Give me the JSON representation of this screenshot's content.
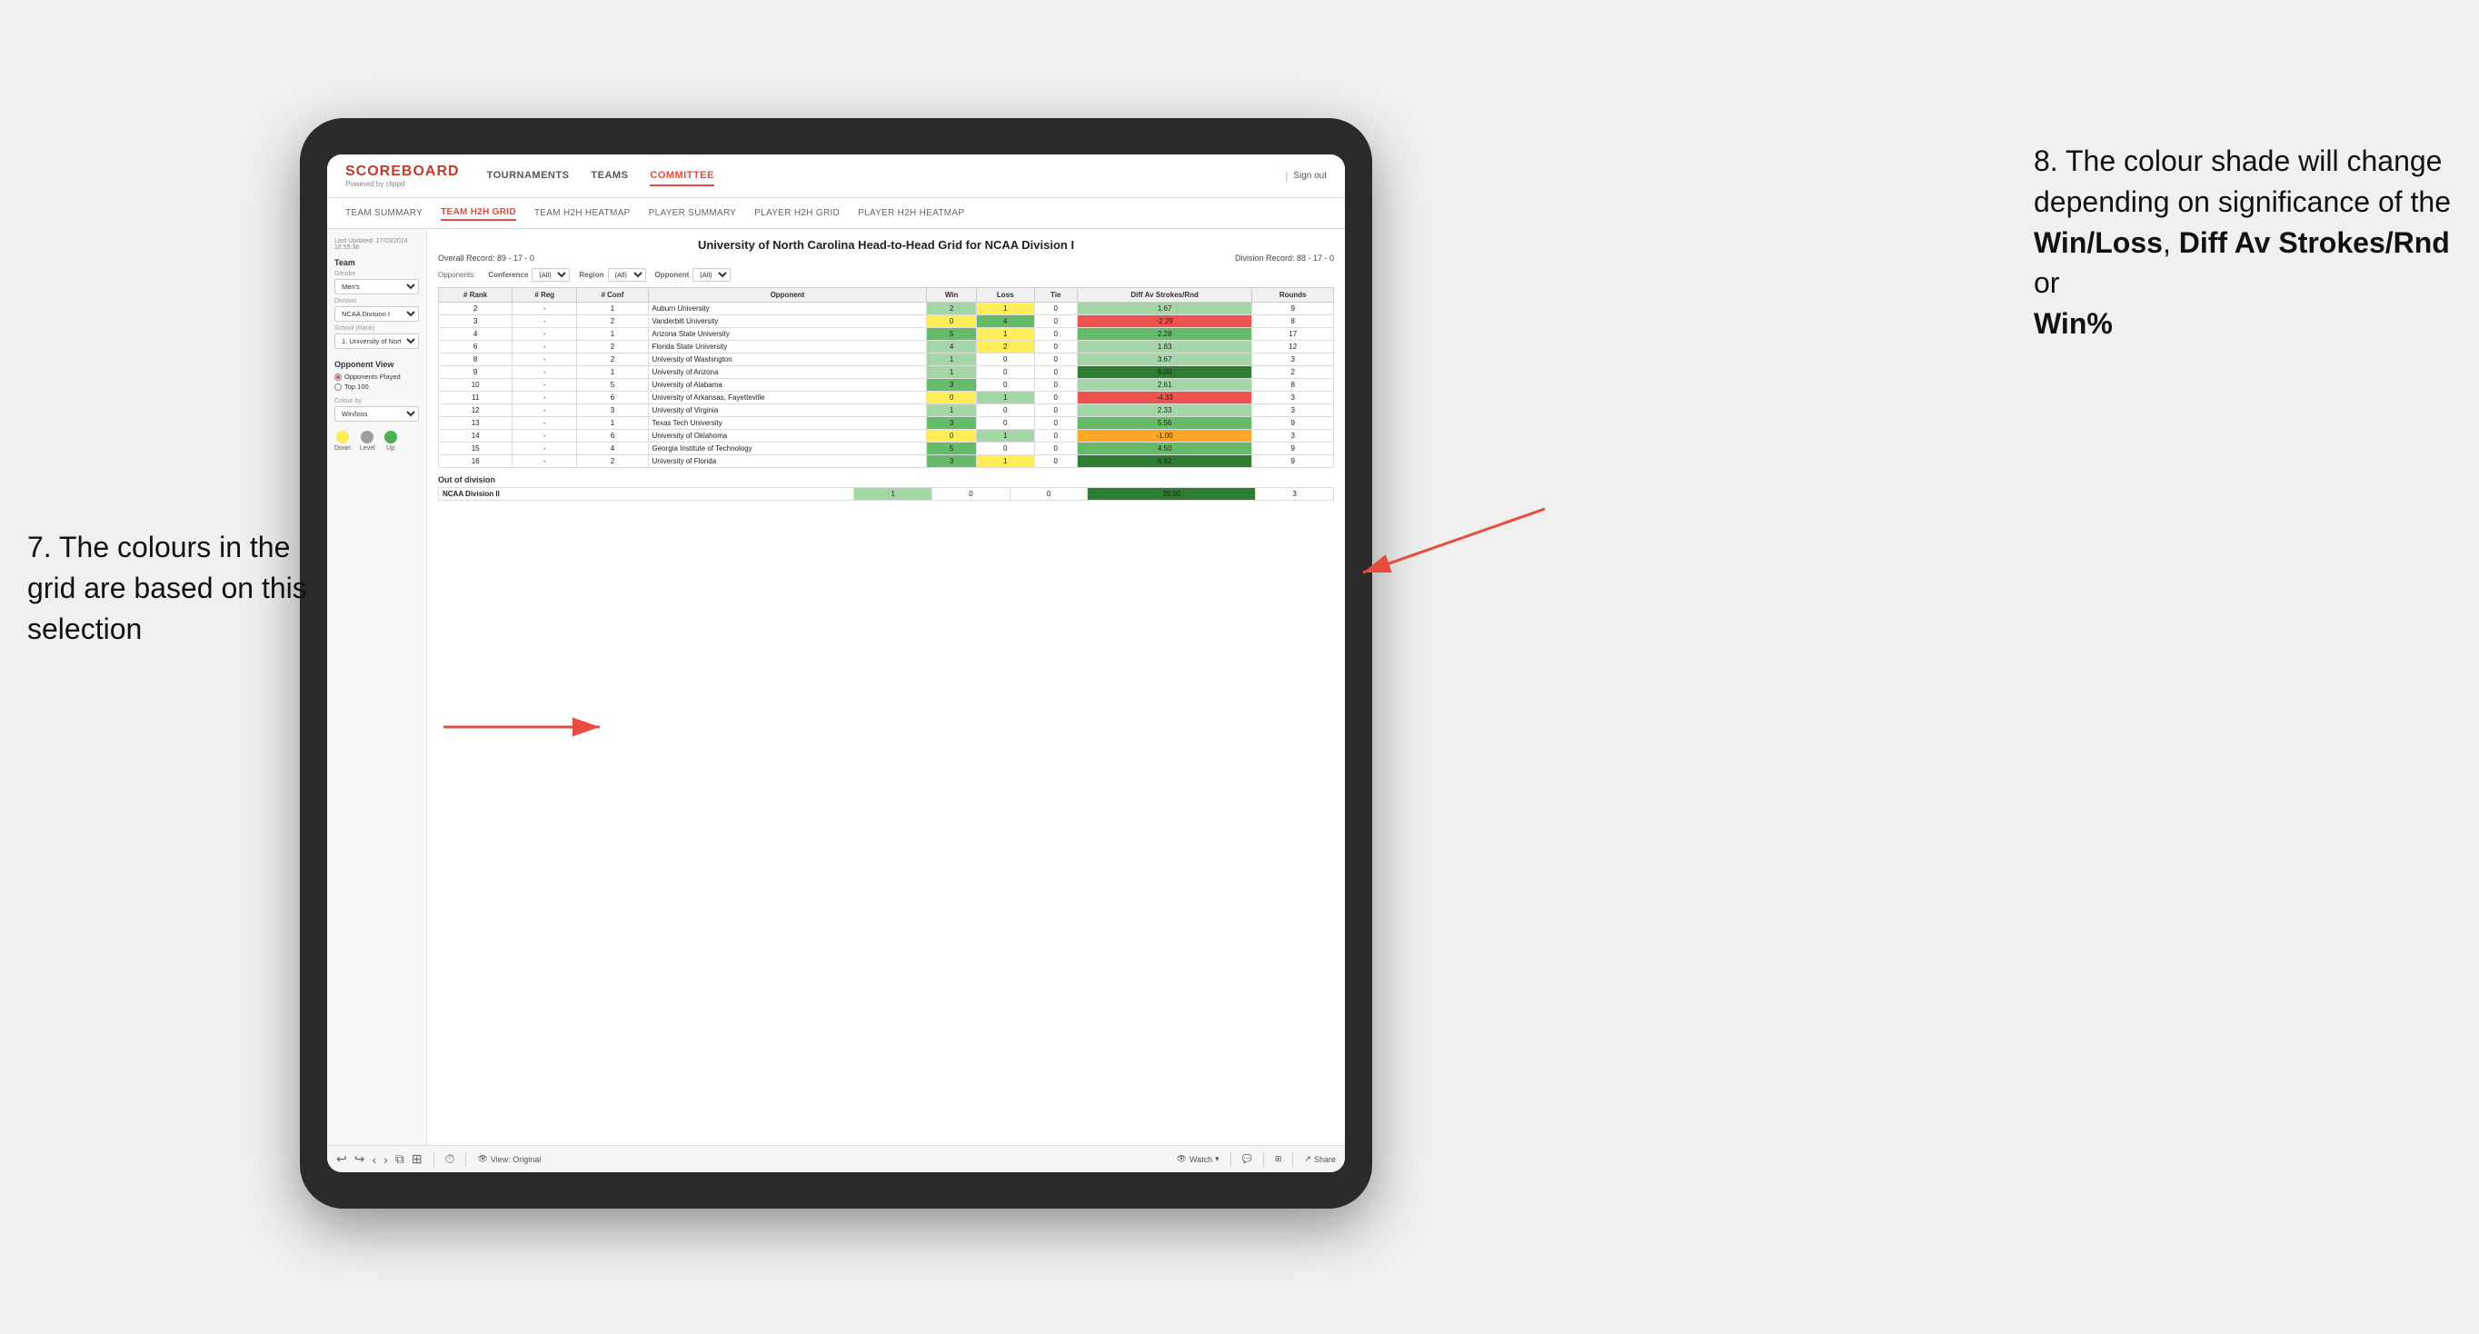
{
  "annotations": {
    "left_title": "7. The colours in the grid are based on this selection",
    "right_title": "8. The colour shade will change depending on significance of the",
    "right_bold1": "Win/Loss",
    "right_comma": ", ",
    "right_bold2": "Diff Av Strokes/Rnd",
    "right_or": " or",
    "right_bold3": "Win%"
  },
  "header": {
    "logo": "SCOREBOARD",
    "logo_sub": "Powered by clippd",
    "nav_items": [
      "TOURNAMENTS",
      "TEAMS",
      "COMMITTEE"
    ],
    "sign_out": "Sign out"
  },
  "sub_nav": {
    "items": [
      "TEAM SUMMARY",
      "TEAM H2H GRID",
      "TEAM H2H HEATMAP",
      "PLAYER SUMMARY",
      "PLAYER H2H GRID",
      "PLAYER H2H HEATMAP"
    ],
    "active": "TEAM H2H GRID"
  },
  "left_panel": {
    "updated_label": "Last Updated: 27/03/2024",
    "updated_time": "16:55:38",
    "team_section": "Team",
    "gender_label": "Gender",
    "gender_value": "Men's",
    "division_label": "Division",
    "division_value": "NCAA Division I",
    "school_label": "School (Rank)",
    "school_value": "1. University of Nort...",
    "opponent_label": "Opponent View",
    "opponent_options": [
      "Opponents Played",
      "Top 100"
    ],
    "opponent_selected": "Opponents Played",
    "colour_label": "Colour by",
    "colour_value": "Win/loss",
    "legend": {
      "down_label": "Down",
      "level_label": "Level",
      "up_label": "Up",
      "down_color": "#ffee58",
      "level_color": "#9e9e9e",
      "up_color": "#4caf50"
    }
  },
  "report": {
    "title": "University of North Carolina Head-to-Head Grid for NCAA Division I",
    "overall_record": "Overall Record: 89 - 17 - 0",
    "division_record": "Division Record: 88 - 17 - 0",
    "filters": {
      "opponents_label": "Opponents:",
      "conference_label": "Conference",
      "conference_value": "(All)",
      "region_label": "Region",
      "region_value": "(All)",
      "opponent_label": "Opponent",
      "opponent_value": "(All)"
    },
    "table_headers": [
      "#\nRank",
      "#\nReg",
      "#\nConf",
      "Opponent",
      "Win",
      "Loss",
      "Tie",
      "Diff Av\nStrokes/Rnd",
      "Rounds"
    ],
    "rows": [
      {
        "rank": "2",
        "reg": "-",
        "conf": "1",
        "opponent": "Auburn University",
        "win": "2",
        "loss": "1",
        "tie": "0",
        "diff": "1.67",
        "rounds": "9",
        "win_color": "green_light",
        "loss_color": "yellow",
        "diff_color": "green_light"
      },
      {
        "rank": "3",
        "reg": "-",
        "conf": "2",
        "opponent": "Vanderbilt University",
        "win": "0",
        "loss": "4",
        "tie": "0",
        "diff": "-2.29",
        "rounds": "8",
        "win_color": "yellow",
        "loss_color": "green_med",
        "diff_color": "red"
      },
      {
        "rank": "4",
        "reg": "-",
        "conf": "1",
        "opponent": "Arizona State University",
        "win": "5",
        "loss": "1",
        "tie": "0",
        "diff": "2.28",
        "rounds": "17",
        "win_color": "green_med",
        "loss_color": "yellow",
        "diff_color": "green_med"
      },
      {
        "rank": "6",
        "reg": "-",
        "conf": "2",
        "opponent": "Florida State University",
        "win": "4",
        "loss": "2",
        "tie": "0",
        "diff": "1.83",
        "rounds": "12",
        "win_color": "green_light",
        "loss_color": "yellow",
        "diff_color": "green_light"
      },
      {
        "rank": "8",
        "reg": "-",
        "conf": "2",
        "opponent": "University of Washington",
        "win": "1",
        "loss": "0",
        "tie": "0",
        "diff": "3.67",
        "rounds": "3",
        "win_color": "green_light",
        "loss_color": "neutral",
        "diff_color": "green_light"
      },
      {
        "rank": "9",
        "reg": "-",
        "conf": "1",
        "opponent": "University of Arizona",
        "win": "1",
        "loss": "0",
        "tie": "0",
        "diff": "9.00",
        "rounds": "2",
        "win_color": "green_light",
        "loss_color": "neutral",
        "diff_color": "green_dark"
      },
      {
        "rank": "10",
        "reg": "-",
        "conf": "5",
        "opponent": "University of Alabama",
        "win": "3",
        "loss": "0",
        "tie": "0",
        "diff": "2.61",
        "rounds": "8",
        "win_color": "green_med",
        "loss_color": "neutral",
        "diff_color": "green_light"
      },
      {
        "rank": "11",
        "reg": "-",
        "conf": "6",
        "opponent": "University of Arkansas, Fayetteville",
        "win": "0",
        "loss": "1",
        "tie": "0",
        "diff": "-4.33",
        "rounds": "3",
        "win_color": "yellow",
        "loss_color": "green_light",
        "diff_color": "red"
      },
      {
        "rank": "12",
        "reg": "-",
        "conf": "3",
        "opponent": "University of Virginia",
        "win": "1",
        "loss": "0",
        "tie": "0",
        "diff": "2.33",
        "rounds": "3",
        "win_color": "green_light",
        "loss_color": "neutral",
        "diff_color": "green_light"
      },
      {
        "rank": "13",
        "reg": "-",
        "conf": "1",
        "opponent": "Texas Tech University",
        "win": "3",
        "loss": "0",
        "tie": "0",
        "diff": "5.56",
        "rounds": "9",
        "win_color": "green_med",
        "loss_color": "neutral",
        "diff_color": "green_med"
      },
      {
        "rank": "14",
        "reg": "-",
        "conf": "6",
        "opponent": "University of Oklahoma",
        "win": "0",
        "loss": "1",
        "tie": "0",
        "diff": "-1.00",
        "rounds": "3",
        "win_color": "yellow",
        "loss_color": "green_light",
        "diff_color": "orange"
      },
      {
        "rank": "15",
        "reg": "-",
        "conf": "4",
        "opponent": "Georgia Institute of Technology",
        "win": "5",
        "loss": "0",
        "tie": "0",
        "diff": "4.50",
        "rounds": "9",
        "win_color": "green_med",
        "loss_color": "neutral",
        "diff_color": "green_med"
      },
      {
        "rank": "16",
        "reg": "-",
        "conf": "2",
        "opponent": "University of Florida",
        "win": "3",
        "loss": "1",
        "tie": "0",
        "diff": "6.62",
        "rounds": "9",
        "win_color": "green_med",
        "loss_color": "yellow",
        "diff_color": "green_dark"
      }
    ],
    "out_of_division_label": "Out of division",
    "out_of_division_row": {
      "division": "NCAA Division II",
      "win": "1",
      "loss": "0",
      "tie": "0",
      "diff": "26.00",
      "rounds": "3",
      "win_color": "green_light",
      "diff_color": "green_dark"
    }
  },
  "toolbar": {
    "view_label": "View: Original",
    "watch_label": "Watch",
    "share_label": "Share"
  }
}
